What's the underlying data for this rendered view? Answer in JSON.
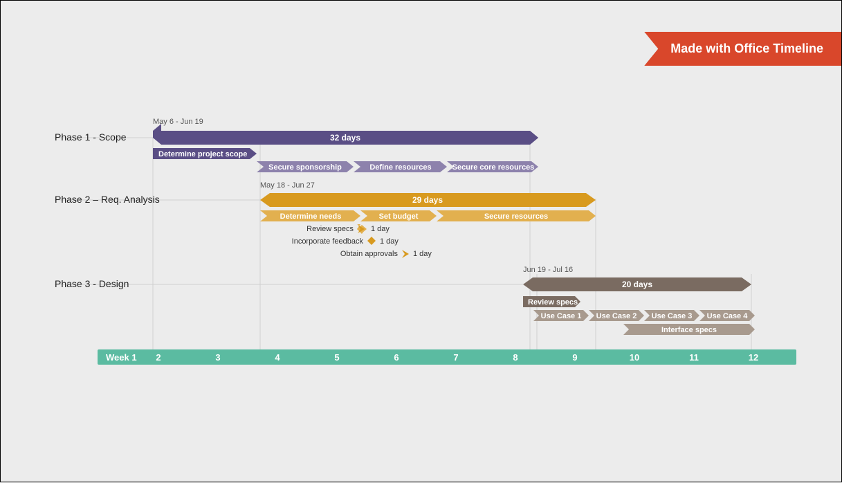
{
  "ribbon": "Made with Office Timeline",
  "phases": {
    "p1": {
      "label": "Phase 1 - Scope",
      "dateRange": "May 6 - Jun 19",
      "duration": "32 days"
    },
    "p2": {
      "label": "Phase 2 – Req. Analysis",
      "dateRange": "May 18 - Jun 27",
      "duration": "29 days"
    },
    "p3": {
      "label": "Phase 3 - Design",
      "dateRange": "Jun 19 - Jul 16",
      "duration": "20 days"
    }
  },
  "tasks": {
    "p1": {
      "t1": "Determine project scope",
      "t2": "Secure sponsorship",
      "t3": "Define resources",
      "t4": "Secure core resources"
    },
    "p2": {
      "t1": "Determine needs",
      "t2": "Set budget",
      "t3": "Secure resources"
    },
    "p3": {
      "t1": "Review specs",
      "t2": "Use Case 1",
      "t3": "Use Case 2",
      "t4": "Use Case 3",
      "t5": "Use Case 4",
      "t6": "Interface specs"
    }
  },
  "milestones": {
    "m1": {
      "label": "Review specs",
      "duration": "1 day"
    },
    "m2": {
      "label": "Incorporate feedback",
      "duration": "1 day"
    },
    "m3": {
      "label": "Obtain approvals",
      "duration": "1 day"
    }
  },
  "weeks": {
    "w1": "Week 1",
    "w2": "2",
    "w3": "3",
    "w4": "4",
    "w5": "5",
    "w6": "6",
    "w7": "7",
    "w8": "8",
    "w9": "9",
    "w10": "10",
    "w11": "11",
    "w12": "12"
  },
  "colors": {
    "purple": "#5a4e85",
    "purpleLight": "#8d82ac",
    "gold": "#d89a1f",
    "goldLight": "#e2b04f",
    "brown": "#7a6b61",
    "brownLight": "#a89a8e",
    "green": "#5bbba1"
  }
}
